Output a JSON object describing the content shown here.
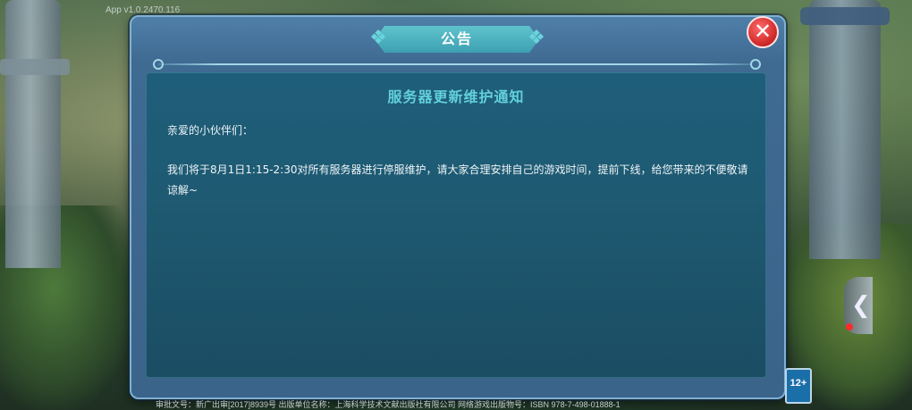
{
  "app": {
    "version_text": "App v1.0.2470.116"
  },
  "dialog": {
    "title": "公告",
    "notice_title": "服务器更新维护通知",
    "greeting": "亲爱的小伙伴们：",
    "body": "我们将于8月1日1:15-2:30对所有服务器进行停服维护，请大家合理安排自己的游戏时间，提前下线，给您带来的不便敬请谅解~",
    "close_icon": "close-icon"
  },
  "side": {
    "arrow_icon": "chevron-left-icon"
  },
  "age_rating": "12+",
  "footer_text": "审批文号：新广出审[2017]8939号 出版单位名称：上海科学技术文献出版社有限公司 网络游戏出版物号：ISBN 978-7-498-01888-1",
  "colors": {
    "accent": "#62d0da",
    "close": "#d12a2a",
    "panel": "#1e5a72"
  }
}
